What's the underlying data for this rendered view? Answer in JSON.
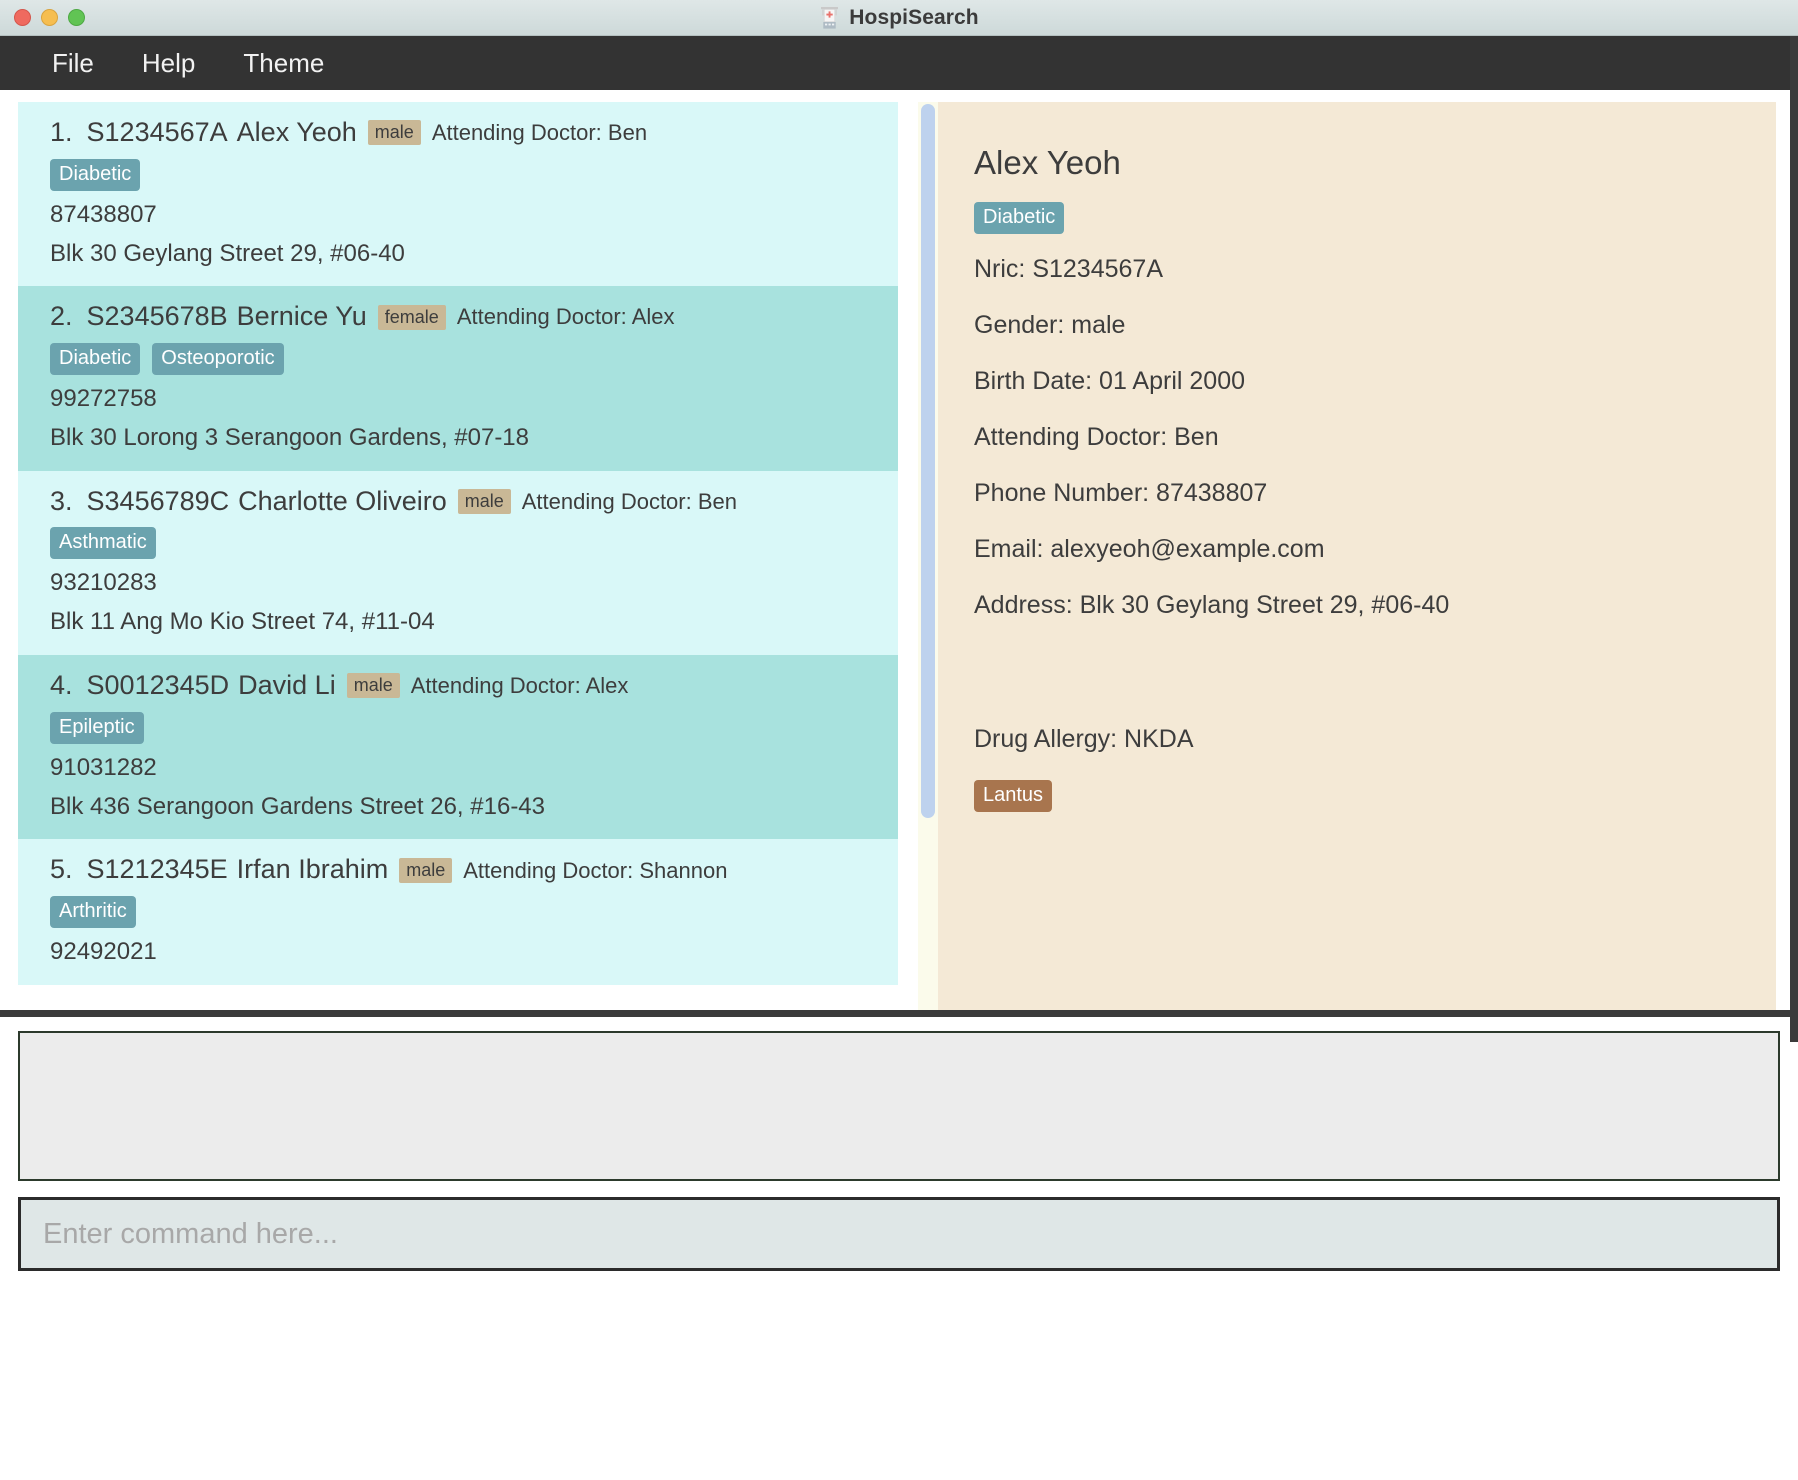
{
  "window": {
    "title": "HospiSearch",
    "icon": "hospital-icon",
    "traffic_lights": [
      "close",
      "minimize",
      "maximize"
    ]
  },
  "menubar": {
    "items": [
      {
        "label": "File"
      },
      {
        "label": "Help"
      },
      {
        "label": "Theme"
      }
    ]
  },
  "colors": {
    "menubar_bg": "#333333",
    "list_row_bg": "#d9f8f8",
    "list_row_alt_bg": "#a8e2de",
    "detail_bg": "#f4e9d6",
    "tag_bg": "#6ba3ae",
    "allergy_tag_bg": "#a8754e",
    "gender_badge_bg": "#c9b896",
    "scrollbar_thumb": "#bed2ee",
    "command_box_bg": "#dfe7e7",
    "result_display_bg": "#ececec"
  },
  "patient_list": [
    {
      "index": "1.",
      "nric": "S1234567A",
      "name": "Alex Yeoh",
      "gender": "male",
      "doctor_label": "Attending Doctor: Ben",
      "tags": [
        "Diabetic"
      ],
      "phone": "87438807",
      "address": "Blk 30 Geylang Street 29, #06-40"
    },
    {
      "index": "2.",
      "nric": "S2345678B",
      "name": "Bernice Yu",
      "gender": "female",
      "doctor_label": "Attending Doctor: Alex",
      "tags": [
        "Diabetic",
        "Osteoporotic"
      ],
      "phone": "99272758",
      "address": "Blk 30 Lorong 3 Serangoon Gardens, #07-18"
    },
    {
      "index": "3.",
      "nric": "S3456789C",
      "name": "Charlotte Oliveiro",
      "gender": "male",
      "doctor_label": "Attending Doctor: Ben",
      "tags": [
        "Asthmatic"
      ],
      "phone": "93210283",
      "address": "Blk 11 Ang Mo Kio Street 74, #11-04"
    },
    {
      "index": "4.",
      "nric": "S0012345D",
      "name": "David Li",
      "gender": "male",
      "doctor_label": "Attending Doctor: Alex",
      "tags": [
        "Epileptic"
      ],
      "phone": "91031282",
      "address": "Blk 436 Serangoon Gardens Street 26, #16-43"
    },
    {
      "index": "5.",
      "nric": "S1212345E",
      "name": "Irfan Ibrahim",
      "gender": "male",
      "doctor_label": "Attending Doctor: Shannon",
      "tags": [
        "Arthritic"
      ],
      "phone": "92492021",
      "address": ""
    }
  ],
  "detail": {
    "name": "Alex Yeoh",
    "tags": [
      "Diabetic"
    ],
    "nric": "Nric: S1234567A",
    "gender": "Gender: male",
    "birth_date": "Birth Date: 01 April 2000",
    "doctor": "Attending Doctor: Ben",
    "phone": "Phone Number: 87438807",
    "email": "Email: alexyeoh@example.com",
    "address": "Address: Blk 30 Geylang Street 29, #06-40",
    "drug_allergy": "Drug Allergy: NKDA",
    "allergy_tags": [
      "Lantus"
    ]
  },
  "result_display": {
    "text": ""
  },
  "command_box": {
    "value": "",
    "placeholder": "Enter command here..."
  }
}
